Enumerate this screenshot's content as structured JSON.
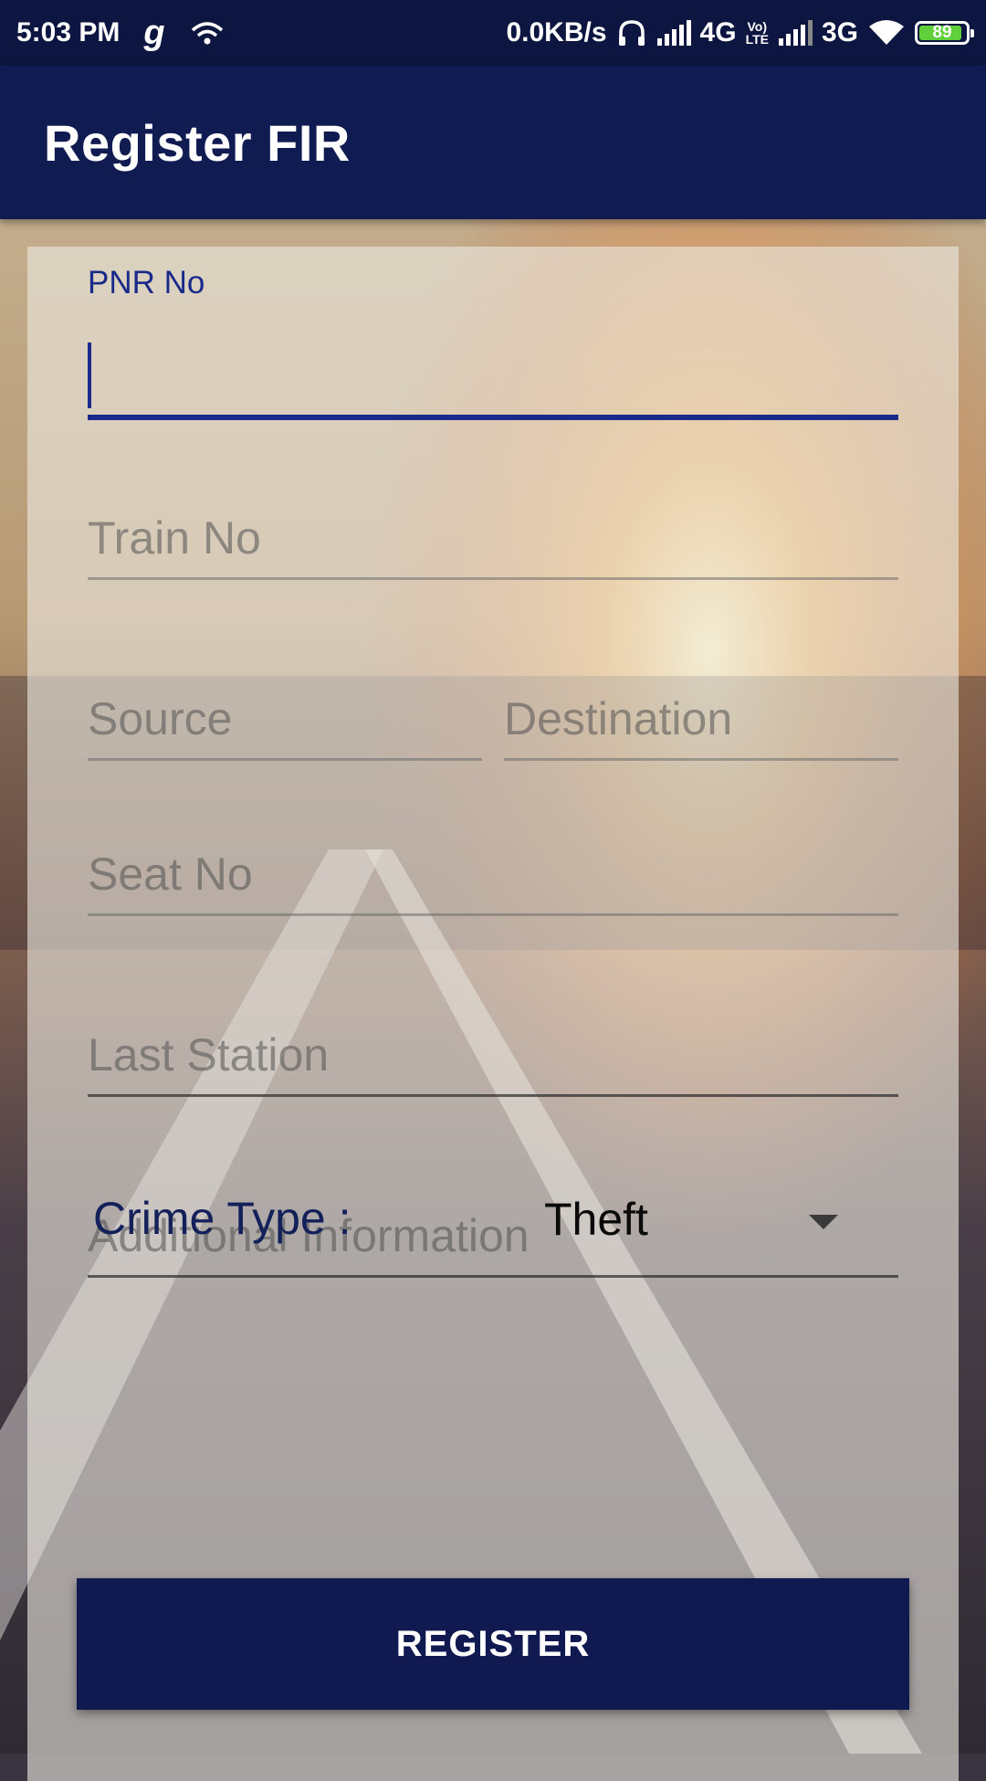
{
  "status_bar": {
    "time": "5:03 PM",
    "app_icon": "g",
    "data_rate": "0.0KB/s",
    "network1": "4G",
    "volte": [
      "Vo)",
      "LTE"
    ],
    "network2": "3G",
    "battery": "89",
    "icons": [
      "wifi-hotspot-icon",
      "headphones-icon",
      "signal-icon",
      "signal-icon",
      "wifi-icon"
    ]
  },
  "app_bar": {
    "title": "Register FIR"
  },
  "form": {
    "pnr": {
      "label": "PNR No",
      "value": ""
    },
    "train": {
      "hint": "Train No"
    },
    "source": {
      "hint": "Source"
    },
    "destination": {
      "hint": "Destination"
    },
    "seat": {
      "hint": "Seat No"
    },
    "last_station": {
      "hint": "Last Station"
    },
    "additional": {
      "hint": "Additional Information"
    },
    "crime_type": {
      "label": "Crime Type :",
      "selected": "Theft"
    },
    "register_label": "REGISTER"
  },
  "colors": {
    "primary_dark": "#0d1640",
    "primary": "#101b52",
    "accent": "#1a2a8a",
    "battery": "#5fd03a"
  }
}
